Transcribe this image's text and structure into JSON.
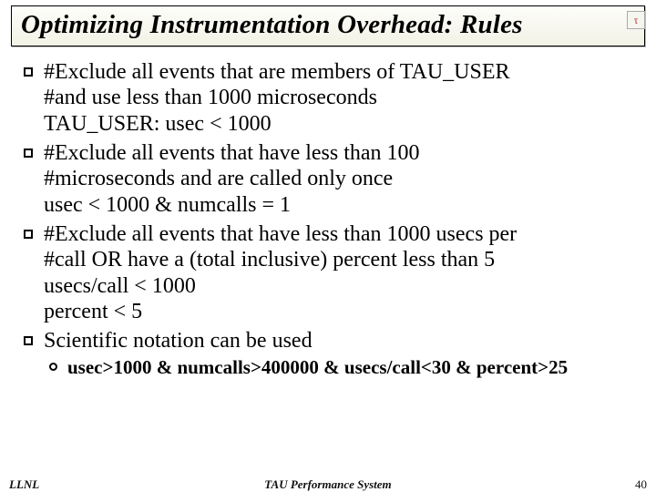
{
  "title": "Optimizing Instrumentation Overhead: Rules",
  "corner_logo": "τ",
  "bullets": [
    {
      "lines": [
        "#Exclude all events that are members of TAU_USER",
        "#and use less than 1000 microseconds",
        "TAU_USER: usec < 1000"
      ]
    },
    {
      "lines": [
        "#Exclude all events that have less than 100",
        "#microseconds and are called only once",
        "usec < 1000 & numcalls = 1"
      ]
    },
    {
      "lines": [
        "#Exclude all events that have less than 1000 usecs per",
        "#call OR have a (total inclusive) percent less than 5",
        "usecs/call < 1000",
        "percent < 5"
      ]
    },
    {
      "lines": [
        "Scientific notation can be used"
      ],
      "sub": [
        "usec>1000 & numcalls>400000 & usecs/call<30 & percent>25"
      ]
    }
  ],
  "footer": {
    "left": "LLNL",
    "center": "TAU Performance System",
    "right": "40"
  }
}
